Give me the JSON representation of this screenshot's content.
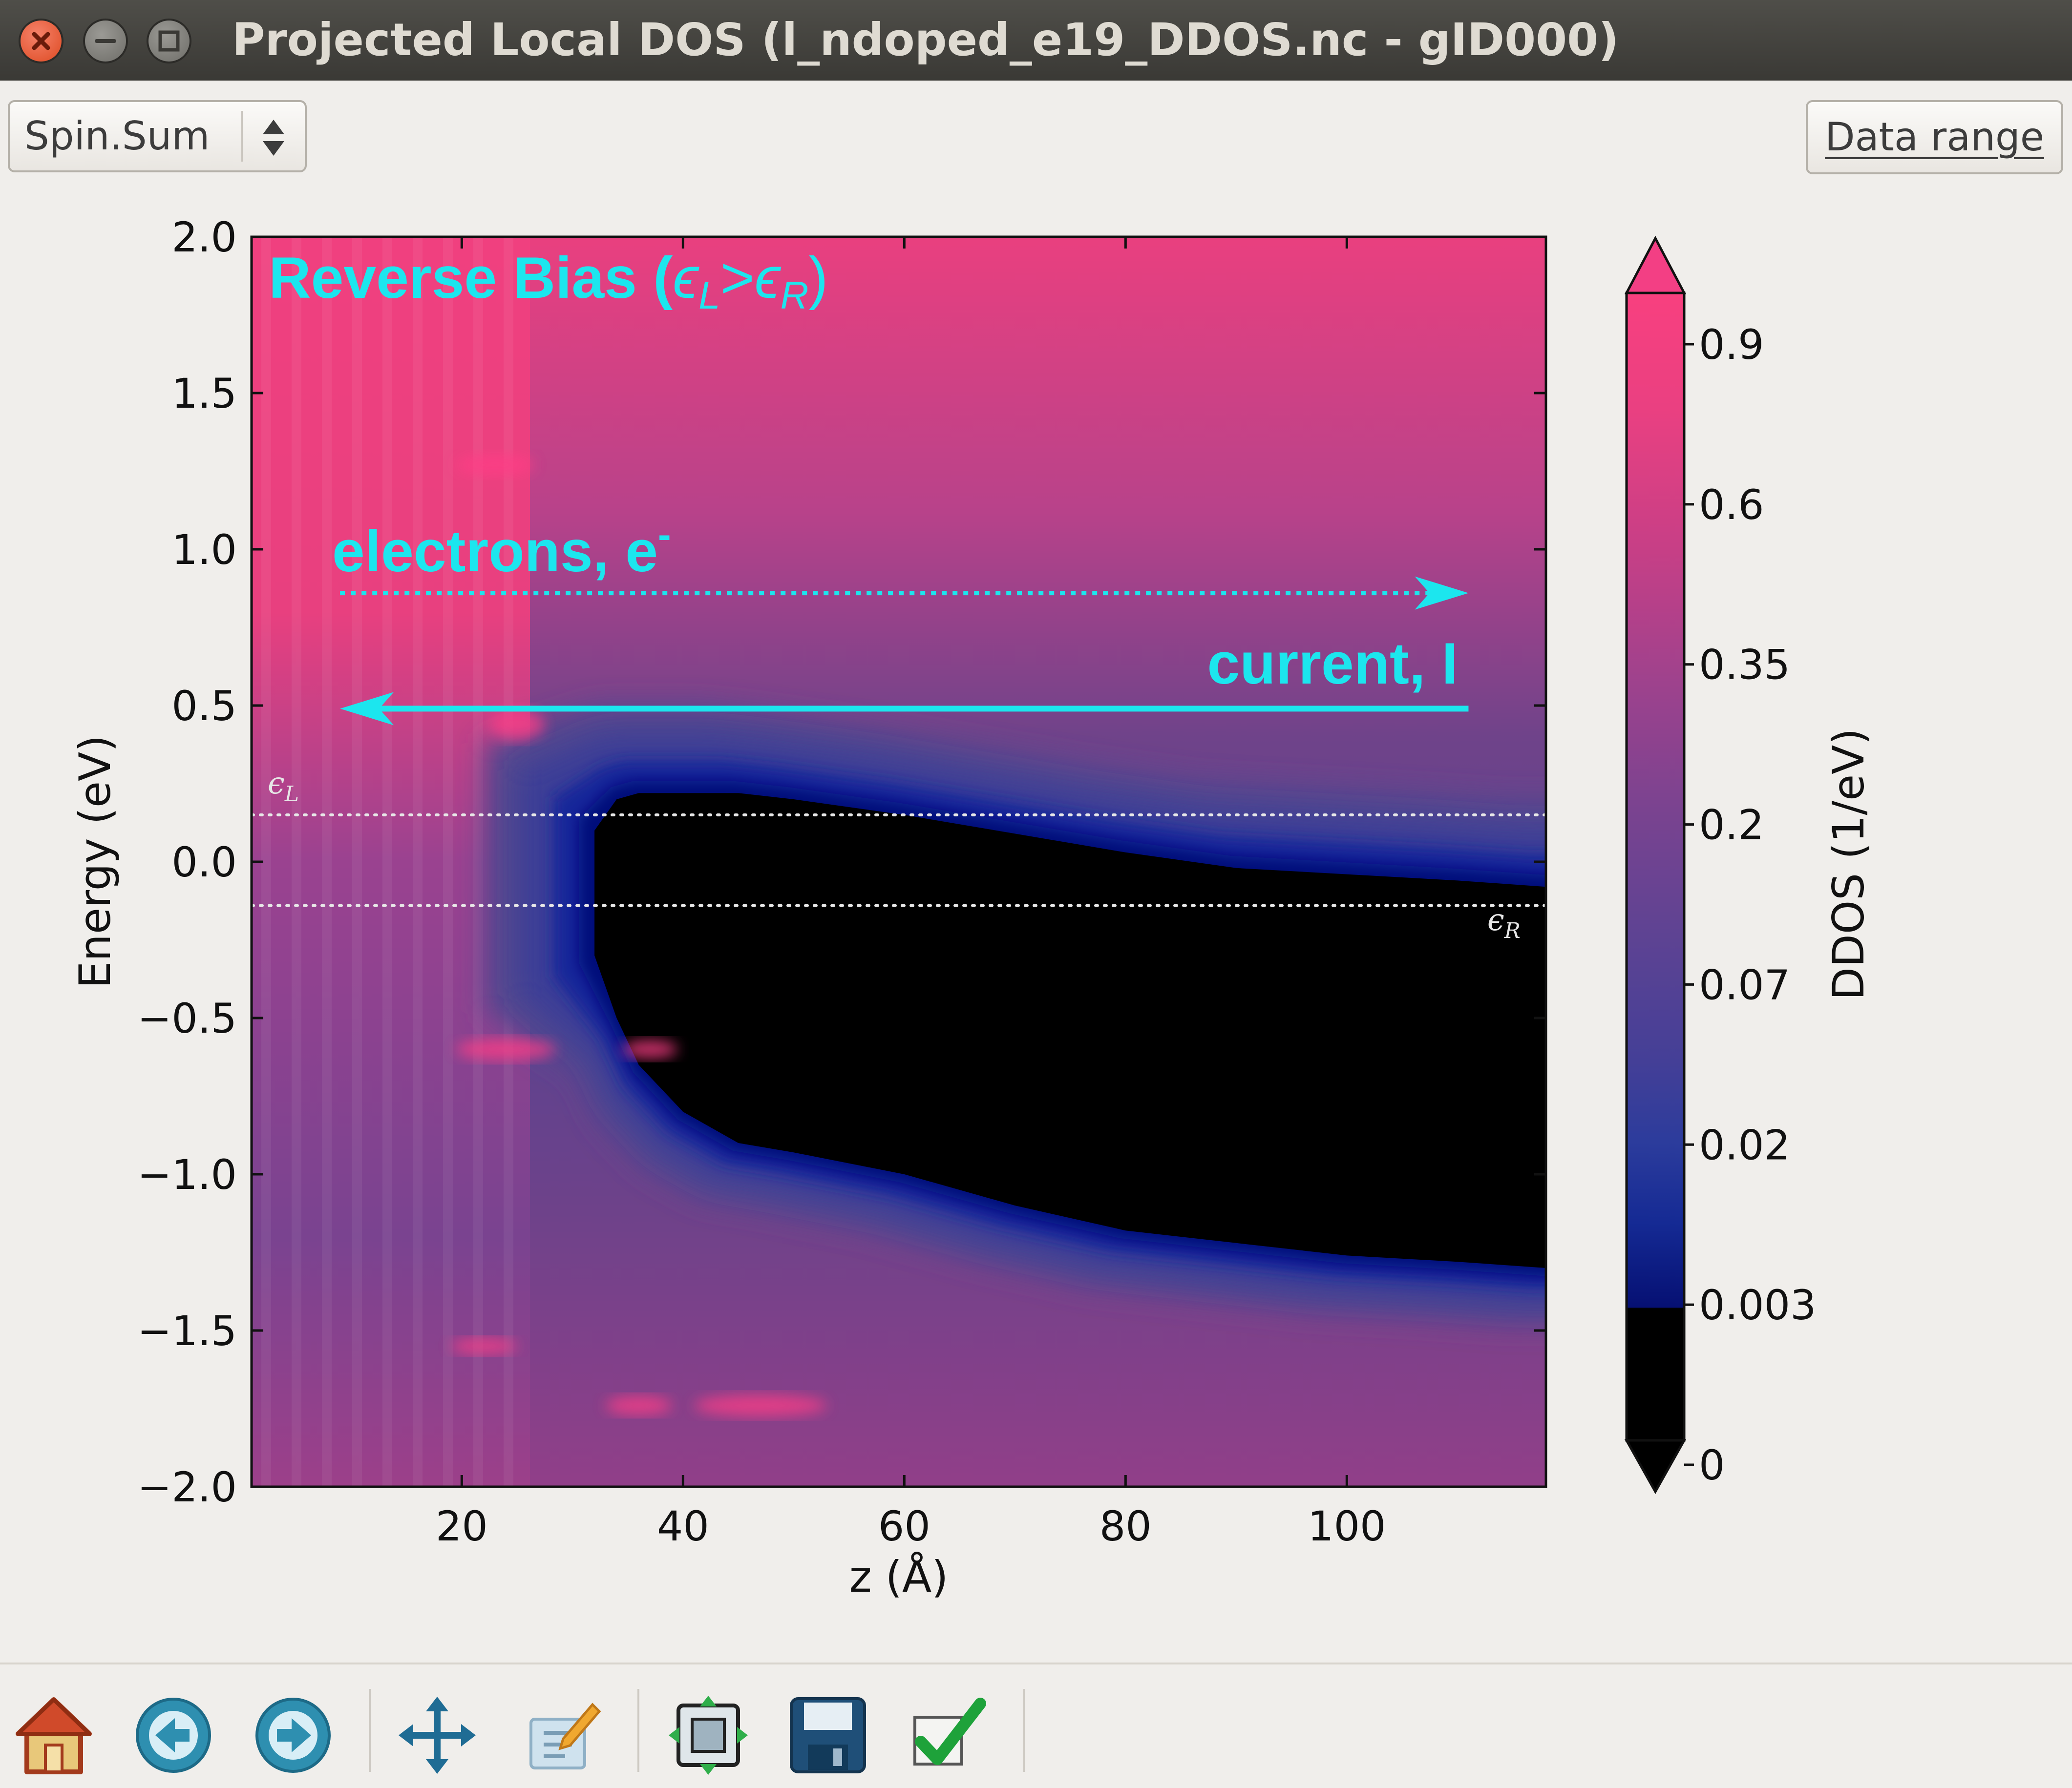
{
  "window": {
    "title": "Projected Local DOS (l_ndoped_e19_DDOS.nc - gID000)"
  },
  "controls": {
    "spin_select": "Spin.Sum",
    "data_range_label": "Data range"
  },
  "plot": {
    "annotations": {
      "bias_prefix": "Reverse Bias (",
      "eps_symbol": "ϵ",
      "sub_L": "L",
      "greater": ">",
      "sub_R": "R",
      "bias_suffix": ")",
      "electrons": "electrons, e",
      "electrons_sup": "-",
      "current": "current, I"
    },
    "level_markers": {
      "left_eps": "ϵ",
      "left_sub": "L",
      "right_eps": "ϵ",
      "right_sub": "R"
    }
  },
  "chart_data": {
    "type": "heatmap",
    "xlabel": "z (Å)",
    "ylabel": "Energy (eV)",
    "xlim": [
      1,
      118
    ],
    "ylim": [
      -2.0,
      2.0
    ],
    "xticks": [
      20,
      40,
      60,
      80,
      100
    ],
    "xtick_labels": [
      "20",
      "40",
      "60",
      "80",
      "100"
    ],
    "yticks": [
      2.0,
      1.5,
      1.0,
      0.5,
      0.0,
      -0.5,
      -1.0,
      -1.5,
      -2.0
    ],
    "ytick_labels": [
      "2.0",
      "1.5",
      "1.0",
      "0.5",
      "0.0",
      "−0.5",
      "−1.0",
      "−1.5",
      "−2.0"
    ],
    "colorbar": {
      "label": "DDOS (1/eV)",
      "tick_labels": [
        "0",
        "0.003",
        "0.02",
        "0.07",
        "0.2",
        "0.35",
        "0.6",
        "0.9"
      ],
      "colors": [
        "#000000",
        "#0b1a8a",
        "#2a3c9a",
        "#4e4596",
        "#6e4389",
        "#9a4290",
        "#c83f86",
        "#f33f84"
      ]
    },
    "fermi_levels": {
      "eps_L": 0.15,
      "eps_R": -0.14
    },
    "arrows": [
      {
        "label": "electrons",
        "direction": "right",
        "style": "dotted",
        "y": 0.86,
        "x_from": 9,
        "x_to": 111
      },
      {
        "label": "current",
        "direction": "left",
        "style": "solid",
        "y": 0.49,
        "x_from": 111,
        "x_to": 9
      }
    ],
    "depletion_boundary": {
      "z": [
        32,
        34,
        36,
        40,
        45,
        50,
        60,
        70,
        80,
        90,
        100,
        110,
        118
      ],
      "upper": [
        0.1,
        0.2,
        0.22,
        0.22,
        0.22,
        0.2,
        0.15,
        0.09,
        0.03,
        -0.02,
        -0.04,
        -0.06,
        -0.08
      ],
      "lower": [
        -0.3,
        -0.5,
        -0.65,
        -0.8,
        -0.9,
        -0.93,
        -1.0,
        -1.1,
        -1.18,
        -1.22,
        -1.26,
        -1.28,
        -1.3
      ]
    },
    "accent_color": "#1ce6ee"
  },
  "toolbar": {
    "icons": [
      "home-icon",
      "back-icon",
      "forward-icon",
      "pan-icon",
      "edit-axes-icon",
      "subplots-icon",
      "save-icon",
      "apply-icon"
    ]
  }
}
